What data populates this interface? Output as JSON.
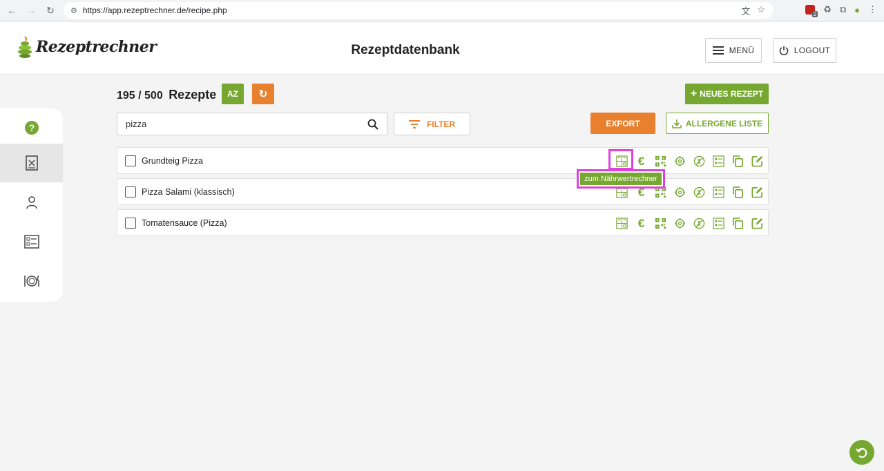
{
  "browser": {
    "url": "https://app.rezeptrechner.de/recipe.php"
  },
  "header": {
    "logo_text": "Rezeptrechner",
    "title": "Rezeptdatenbank",
    "menu_label": "MENÜ",
    "logout_label": "LOGOUT"
  },
  "sidebar": {
    "items": [
      {
        "icon": "help-icon"
      },
      {
        "icon": "recipe-icon",
        "active": true
      },
      {
        "icon": "user-icon"
      },
      {
        "icon": "checklist-icon"
      },
      {
        "icon": "plate-cutlery-icon"
      }
    ]
  },
  "toolbar": {
    "count": "195 / 500",
    "count_label": "Rezepte",
    "sort_label": "AZ",
    "new_recipe_label": "NEUES REZEPT",
    "search_value": "pizza",
    "filter_label": "FILTER",
    "export_label": "EXPORT",
    "allergens_label": "ALLERGENE LISTE"
  },
  "recipes": [
    {
      "name": "Grundteig Pizza"
    },
    {
      "name": "Pizza Salami (klassisch)"
    },
    {
      "name": "Tomatensauce (Pizza)"
    }
  ],
  "row_actions": [
    "nutrition-calculator-icon",
    "euro-icon",
    "qr-code-icon",
    "settings-icon",
    "allergen-icon",
    "list-icon",
    "copy-icon",
    "edit-icon"
  ],
  "tooltip": "zum Nährwertrechner",
  "colors": {
    "green": "#76a831",
    "orange": "#e8802e",
    "highlight": "#e040e0"
  }
}
